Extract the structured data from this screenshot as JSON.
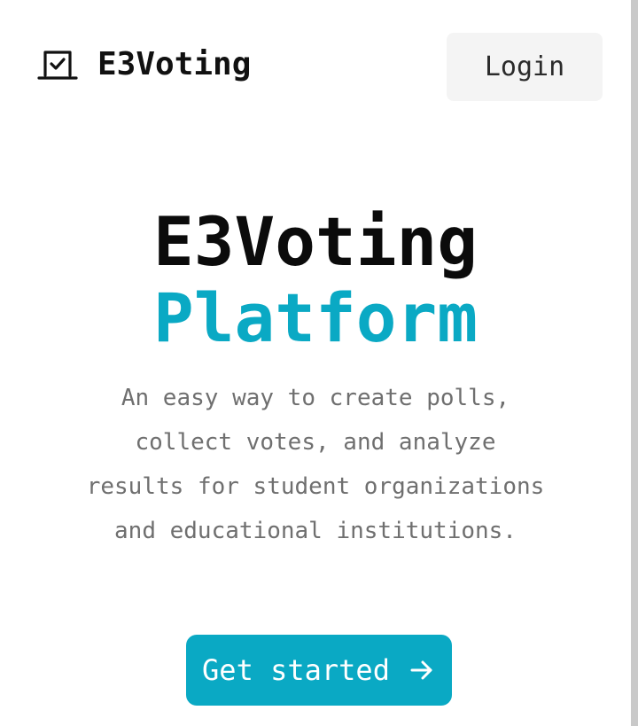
{
  "header": {
    "brand_name": "E3Voting",
    "brand_icon": "ballot-check-icon",
    "login_label": "Login"
  },
  "hero": {
    "title": "E3Voting",
    "accent": "Platform",
    "description": "An easy way to create polls, collect votes, and analyze results for student organizations and educational institutions."
  },
  "cta": {
    "label": "Get started",
    "icon": "arrow-right-icon"
  },
  "colors": {
    "accent": "#0aa9c4",
    "text_primary": "#111111",
    "text_muted": "#6f6f6f",
    "button_bg": "#f4f4f4"
  }
}
